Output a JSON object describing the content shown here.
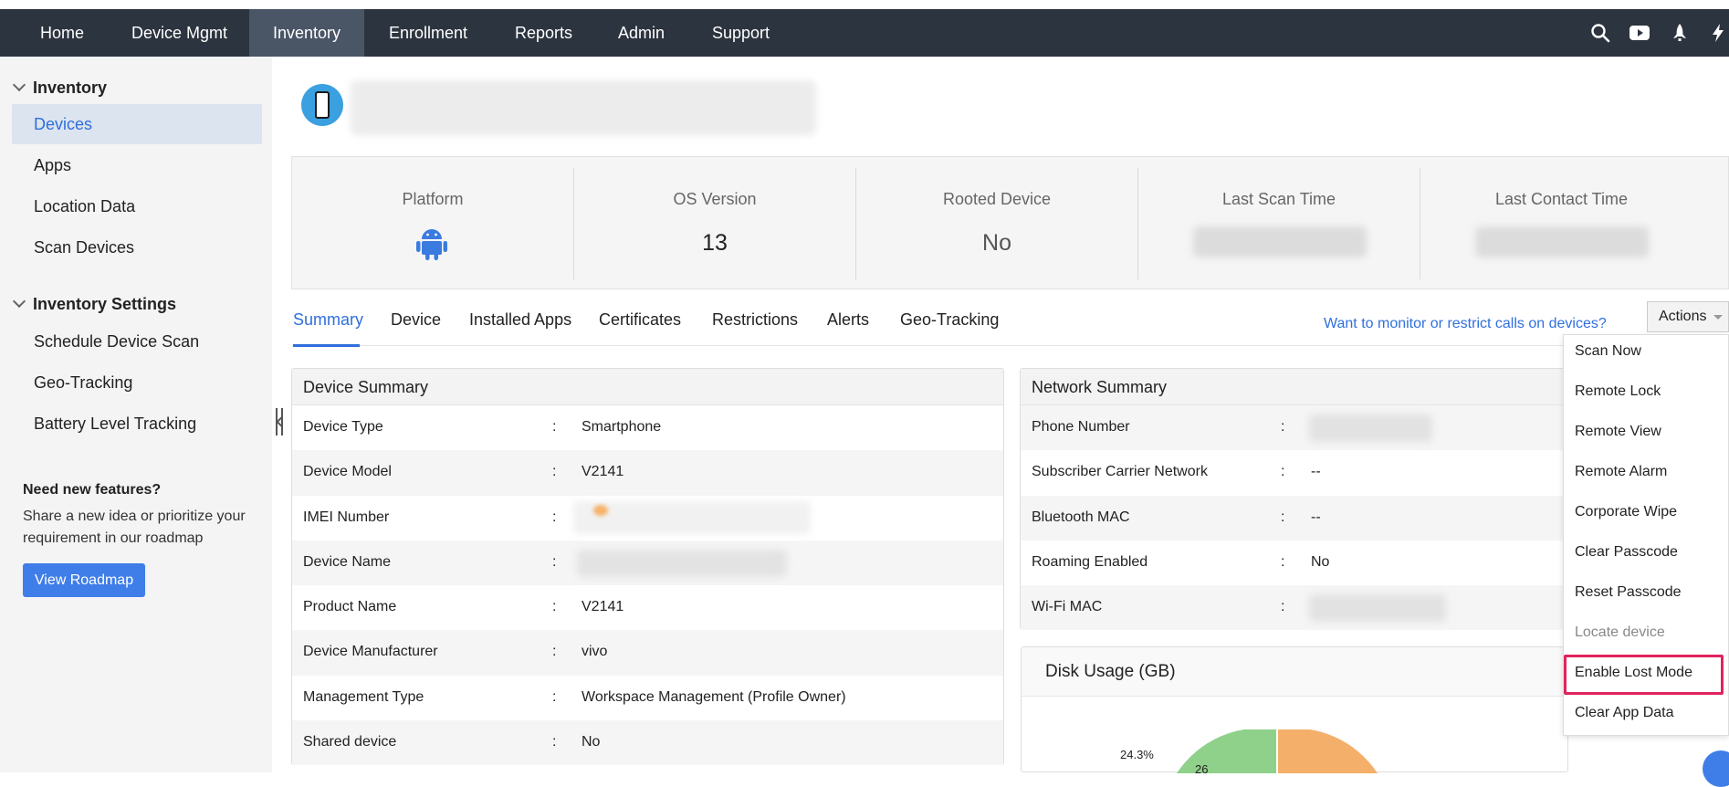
{
  "nav": {
    "items": [
      "Home",
      "Device Mgmt",
      "Inventory",
      "Enrollment",
      "Reports",
      "Admin",
      "Support"
    ],
    "active": "Inventory",
    "icons": [
      "search-icon",
      "youtube-icon",
      "rocket-icon",
      "flash-icon"
    ]
  },
  "sidebar": {
    "section1": "Inventory",
    "items1": [
      "Devices",
      "Apps",
      "Location Data",
      "Scan Devices"
    ],
    "section2": "Inventory Settings",
    "items2": [
      "Schedule Device Scan",
      "Geo-Tracking",
      "Battery Level Tracking"
    ],
    "promo_title": "Need new features?",
    "promo_text": "Share a new idea or prioritize your requirement in our roadmap",
    "roadmap_button": "View Roadmap"
  },
  "stats": {
    "platform_label": "Platform",
    "os_label": "OS Version",
    "os_value": "13",
    "rooted_label": "Rooted Device",
    "rooted_value": "No",
    "scan_label": "Last Scan Time",
    "contact_label": "Last Contact Time"
  },
  "tabs": [
    "Summary",
    "Device",
    "Installed Apps",
    "Certificates",
    "Restrictions",
    "Alerts",
    "Geo-Tracking"
  ],
  "calls_link": "Want to monitor or restrict calls on devices?",
  "actions_label": "Actions",
  "actions_menu": [
    "Scan Now",
    "Remote Lock",
    "Remote View",
    "Remote Alarm",
    "Corporate Wipe",
    "Clear Passcode",
    "Reset Passcode",
    "Locate device",
    "Enable Lost Mode",
    "Clear App Data"
  ],
  "device_summary": {
    "title": "Device Summary",
    "rows": [
      {
        "key": "Device Type",
        "value": "Smartphone"
      },
      {
        "key": "Device Model",
        "value": "V2141"
      },
      {
        "key": "IMEI Number",
        "value": ""
      },
      {
        "key": "Device Name",
        "value": ""
      },
      {
        "key": "Product Name",
        "value": "V2141"
      },
      {
        "key": "Device Manufacturer",
        "value": "vivo"
      },
      {
        "key": "Management Type",
        "value": "Workspace Management (Profile Owner)"
      },
      {
        "key": "Shared device",
        "value": "No"
      }
    ]
  },
  "network_summary": {
    "title": "Network Summary",
    "rows": [
      {
        "key": "Phone Number",
        "value": ""
      },
      {
        "key": "Subscriber Carrier Network",
        "value": "--"
      },
      {
        "key": "Bluetooth MAC",
        "value": "--"
      },
      {
        "key": "Roaming Enabled",
        "value": "No"
      },
      {
        "key": "Wi-Fi MAC",
        "value": ""
      }
    ]
  },
  "disk_usage": {
    "title": "Disk Usage (GB)",
    "label_pct": "24.3%",
    "label_value": "26",
    "colors": {
      "used": "#8fd18a",
      "free": "#f4b06a"
    }
  },
  "separator": ":",
  "colors": {
    "nav_bg": "#2c343f",
    "accent": "#2f6fdd",
    "highlight": "#e0245e"
  }
}
